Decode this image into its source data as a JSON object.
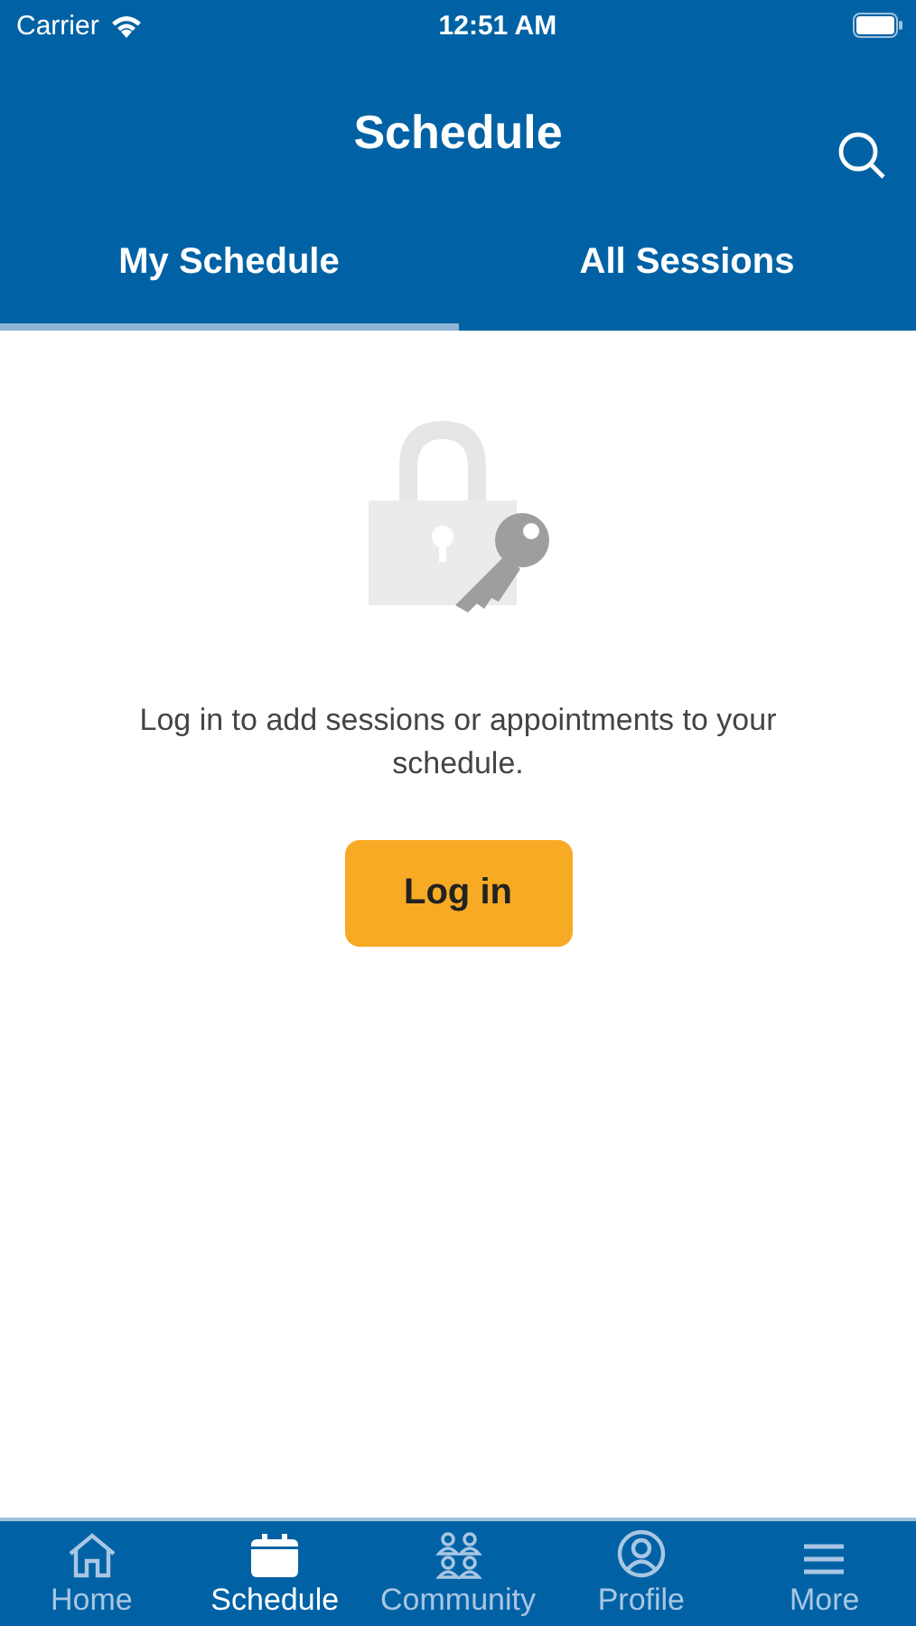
{
  "status_bar": {
    "carrier": "Carrier",
    "time": "12:51 AM"
  },
  "header": {
    "title": "Schedule"
  },
  "tabs": [
    {
      "label": "My Schedule",
      "selected": true
    },
    {
      "label": "All Sessions",
      "selected": false
    }
  ],
  "empty_state": {
    "message": "Log in to add sessions or appointments to your schedule.",
    "button": "Log in"
  },
  "tab_bar": [
    {
      "label": "Home",
      "selected": false
    },
    {
      "label": "Schedule",
      "selected": true
    },
    {
      "label": "Community",
      "selected": false
    },
    {
      "label": "Profile",
      "selected": false
    },
    {
      "label": "More",
      "selected": false
    }
  ]
}
